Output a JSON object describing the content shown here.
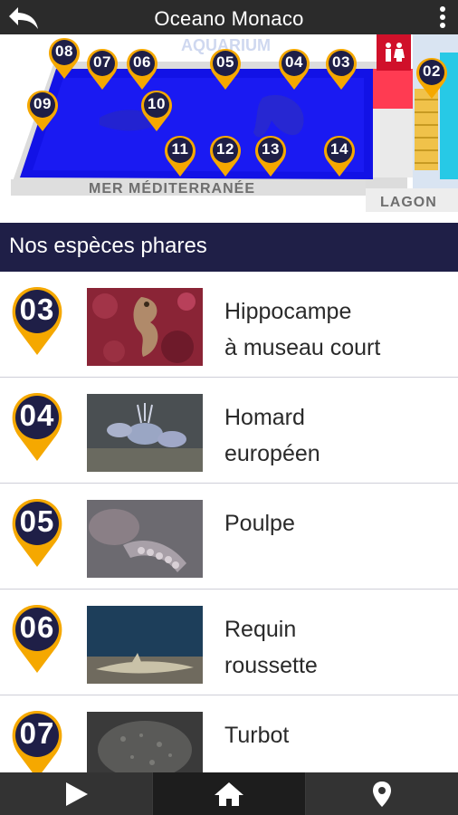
{
  "header": {
    "title": "Oceano Monaco"
  },
  "map": {
    "pins": [
      "08",
      "07",
      "06",
      "05",
      "04",
      "03",
      "02",
      "09",
      "10",
      "11",
      "12",
      "13",
      "14"
    ],
    "labels": {
      "sea": "MER MÉDITERRANÉE",
      "lagoon": "LAGON"
    }
  },
  "section": {
    "title": "Nos espèces phares"
  },
  "species": [
    {
      "num": "03",
      "line1": "Hippocampe",
      "line2": "à museau court"
    },
    {
      "num": "04",
      "line1": "Homard",
      "line2": "européen"
    },
    {
      "num": "05",
      "line1": "Poulpe",
      "line2": ""
    },
    {
      "num": "06",
      "line1": "Requin",
      "line2": "roussette"
    },
    {
      "num": "07",
      "line1": "Turbot",
      "line2": ""
    }
  ],
  "colors": {
    "navy": "#1f1f47",
    "pin": "#f5a800",
    "water": "#1212e6",
    "topbar": "#2b2b2b"
  },
  "nav": {
    "icons": [
      "play-icon",
      "home-icon",
      "location-pin-icon"
    ]
  }
}
